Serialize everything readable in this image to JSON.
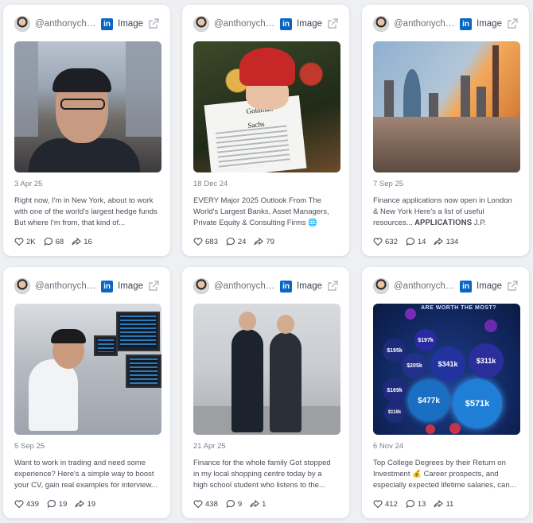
{
  "cards": [
    {
      "handle": "@anthonycheung",
      "platform": "in",
      "type": "Image",
      "date": "3 Apr 25",
      "text": "Right now, I'm in New York, about to work with one of the world's largest hedge funds But where I'm from, that kind of...",
      "likes": "2K",
      "comments": "68",
      "shares": "16"
    },
    {
      "handle": "@anthonycheung",
      "platform": "in",
      "type": "Image",
      "date": "18 Dec 24",
      "text": "EVERY Major 2025 Outlook From The World's Largest Banks, Asset Managers, Private Equity & Consulting Firms 🌐 Gre...",
      "likes": "683",
      "comments": "24",
      "shares": "79",
      "image_text": [
        "Goldman",
        "Sachs"
      ]
    },
    {
      "handle": "@anthonycheung",
      "platform": "in",
      "type": "Image",
      "date": "7 Sep 25",
      "text": "Finance applications now open in London & New York Here's a list of useful resources... 𝐀𝐏𝐏𝐋𝐈𝐂𝐀𝐓𝐈𝐎𝐍𝐒 J.P. Morgan...",
      "likes": "632",
      "comments": "14",
      "shares": "134"
    },
    {
      "handle": "@anthonycheung",
      "platform": "in",
      "type": "Image",
      "date": "5 Sep 25",
      "text": "Want to work in trading and need some experience? Here's a simple way to boost your CV, gain real examples for interview...",
      "likes": "439",
      "comments": "19",
      "shares": "19"
    },
    {
      "handle": "@anthonycheung",
      "platform": "in",
      "type": "Image",
      "date": "21 Apr 25",
      "text": "Finance for the whole family Got stopped in my local shopping centre today by a high school student who listens to the...",
      "likes": "438",
      "comments": "9",
      "shares": "1"
    },
    {
      "handle": "@anthonycheung",
      "platform": "in",
      "type": "Image",
      "date": "6 Nov 24",
      "text": "Top College Degrees by their Return on Investment 💰 Career prospects, and especially expected lifetime salaries, can...",
      "likes": "412",
      "comments": "13",
      "shares": "11",
      "image_text": {
        "title": "ARE WORTH THE MOST?",
        "bubbles": [
          "$571k",
          "$477k",
          "$341k",
          "$311k",
          "$205k",
          "$197k",
          "$195k",
          "$169k",
          "$118k"
        ]
      }
    }
  ],
  "colors": {
    "linkedin": "#0a66c2",
    "card_bg": "#ffffff",
    "page_bg": "#eef0f3"
  }
}
